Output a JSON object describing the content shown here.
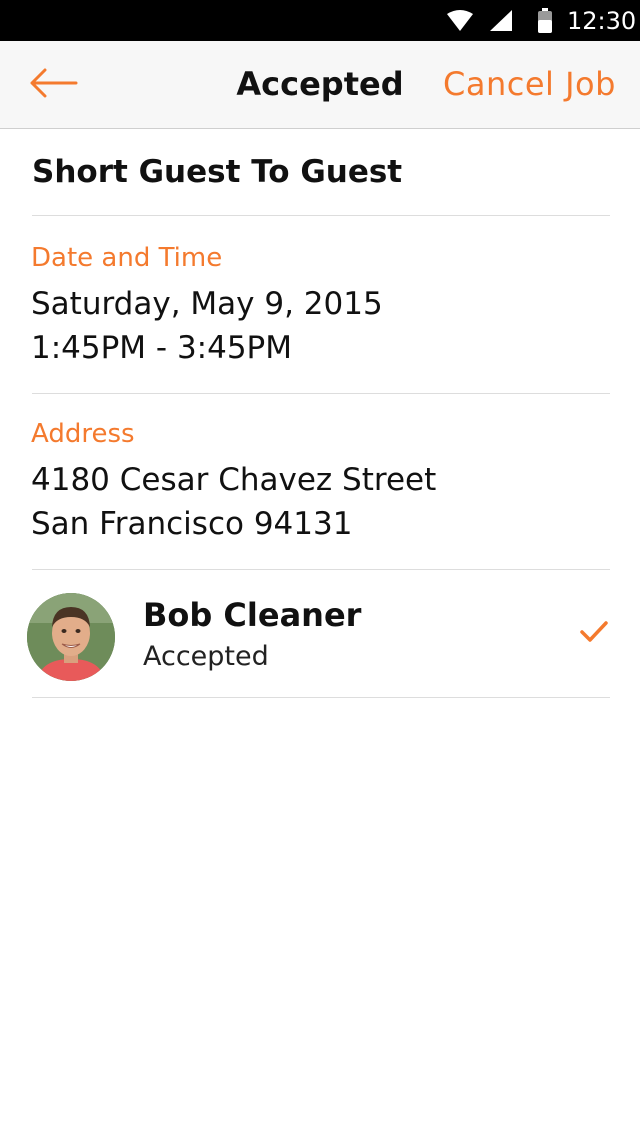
{
  "status_bar": {
    "time": "12:30",
    "icons": [
      "wifi-icon",
      "cell-signal-icon",
      "battery-icon"
    ]
  },
  "app_bar": {
    "back_icon": "arrow-left-icon",
    "title": "Accepted",
    "cancel_label": "Cancel Job"
  },
  "job": {
    "title": "Short Guest To Guest",
    "date_time": {
      "label": "Date and Time",
      "date": "Saturday, May 9, 2015",
      "time": "1:45PM - 3:45PM"
    },
    "address": {
      "label": "Address",
      "line1": "4180 Cesar Chavez Street",
      "line2": "San Francisco 94131"
    },
    "cleaner": {
      "name": "Bob Cleaner",
      "status": "Accepted",
      "status_icon": "checkmark-icon"
    }
  },
  "colors": {
    "accent": "#f47a2e",
    "app_bar_bg": "#f7f7f7",
    "status_bar_bg": "#000000",
    "text": "#111111",
    "divider": "#dddddd"
  }
}
